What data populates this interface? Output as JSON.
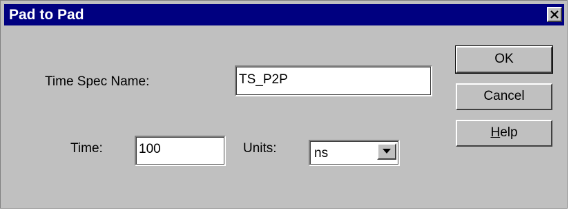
{
  "window": {
    "title": "Pad to Pad"
  },
  "form": {
    "time_spec_name_label": "Time Spec Name:",
    "time_spec_name_value": "TS_P2P",
    "time_label": "Time:",
    "time_value": "100",
    "units_label": "Units:",
    "units_selected": "ns"
  },
  "buttons": {
    "ok_label": "OK",
    "cancel_label": "Cancel",
    "help_label_mnemonic": "H",
    "help_label_rest": "elp"
  },
  "icons": {
    "close": "close-icon",
    "dropdown": "chevron-down-icon"
  },
  "colors": {
    "titlebar": "#000080",
    "dialog_face": "#c0c0c0"
  }
}
